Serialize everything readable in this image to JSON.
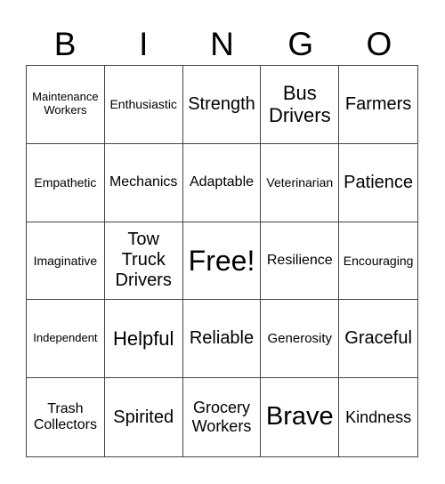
{
  "header": [
    "B",
    "I",
    "N",
    "G",
    "O"
  ],
  "cells": [
    {
      "text": "Maintenance Workers",
      "size": "s13"
    },
    {
      "text": "Enthusiastic",
      "size": "s14"
    },
    {
      "text": "Strength",
      "size": "s20"
    },
    {
      "text": "Bus Drivers",
      "size": "s22"
    },
    {
      "text": "Farmers",
      "size": "s20"
    },
    {
      "text": "Empathetic",
      "size": "s14"
    },
    {
      "text": "Mechanics",
      "size": "s16"
    },
    {
      "text": "Adaptable",
      "size": "s16"
    },
    {
      "text": "Veterinarian",
      "size": "s14"
    },
    {
      "text": "Patience",
      "size": "s20"
    },
    {
      "text": "Imaginative",
      "size": "s14"
    },
    {
      "text": "Tow Truck Drivers",
      "size": "s20"
    },
    {
      "text": "Free!",
      "size": "s32"
    },
    {
      "text": "Resilience",
      "size": "s16"
    },
    {
      "text": "Encouraging",
      "size": "s14"
    },
    {
      "text": "Independent",
      "size": "s13"
    },
    {
      "text": "Helpful",
      "size": "s22"
    },
    {
      "text": "Reliable",
      "size": "s20"
    },
    {
      "text": "Generosity",
      "size": "s15"
    },
    {
      "text": "Graceful",
      "size": "s20"
    },
    {
      "text": "Trash Collectors",
      "size": "s16"
    },
    {
      "text": "Spirited",
      "size": "s20"
    },
    {
      "text": "Grocery Workers",
      "size": "s18"
    },
    {
      "text": "Brave",
      "size": "s29"
    },
    {
      "text": "Kindness",
      "size": "s18"
    }
  ]
}
